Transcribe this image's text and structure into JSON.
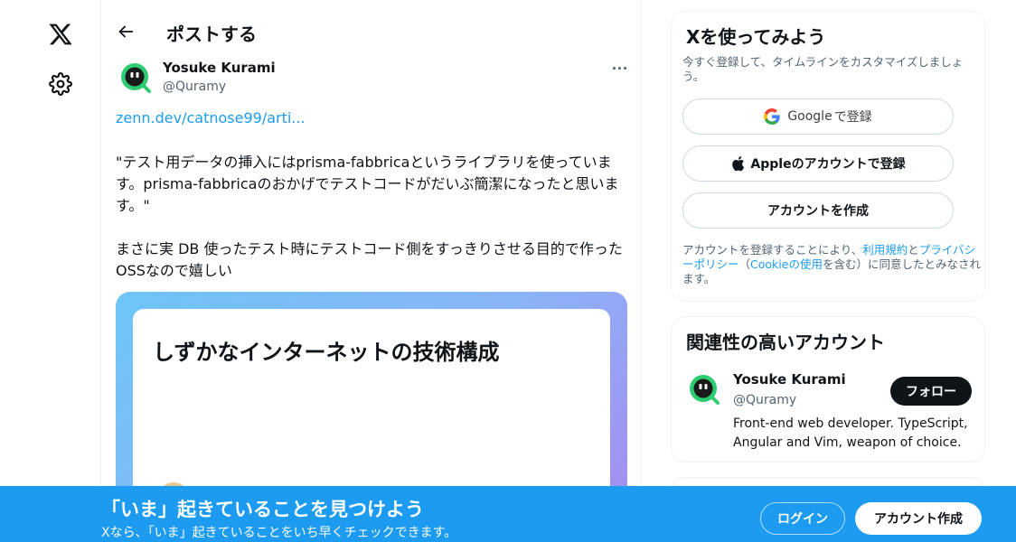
{
  "nav": {
    "logo_icon": "x-logo-icon",
    "settings_icon": "gear-icon"
  },
  "header": {
    "back_icon": "arrow-left-icon",
    "title": "ポストする"
  },
  "post": {
    "author_name": "Yosuke Kurami",
    "author_handle": "@Quramy",
    "link_text": "zenn.dev/catnose99/arti...",
    "paragraphs": [
      "\"テスト用データの挿入にはprisma-fabbricaというライブラリを使っています。prisma-fabbricaのおかげでテストコードがだいぶ簡潔になったと思います。\"",
      "まさに実 DB 使ったテスト時にテストコード側をすっきりさせる目的で作ったOSSなので嬉しい"
    ],
    "card_title": "しずかなインターネットの技術構成"
  },
  "signup": {
    "title": "Xを使ってみよう",
    "subtitle": "今すぐ登録して、タイムラインをカスタマイズしましょう。",
    "google_name": "Google",
    "google_suffix": "で登録",
    "apple_label": "Appleのアカウントで登録",
    "create_label": "アカウントを作成",
    "legal_prefix": "アカウントを登録することにより、",
    "terms_link": "利用規約",
    "legal_and": "と",
    "privacy_link": "プライバシーポリシー",
    "legal_open": "（",
    "cookie_link": "Cookieの使用",
    "legal_suffix": "を含む）に同意したとみなされます。"
  },
  "related": {
    "title": "関連性の高いアカウント",
    "name": "Yosuke Kurami",
    "handle": "@Quramy",
    "follow_label": "フォロー",
    "bio": "Front-end web developer. TypeScript, Angular and Vim, weapon of choice."
  },
  "bottom_bar": {
    "title": "「いま」起きていることを見つけよう",
    "subtitle": "Xなら、「いま」起きていることをいち早くチェックできます。",
    "login_label": "ログイン",
    "signup_label": "アカウント作成"
  },
  "colors": {
    "accent": "#1d9bf0",
    "text": "#0f1419",
    "muted": "#536471",
    "avatar_green": "#2ecc71"
  }
}
